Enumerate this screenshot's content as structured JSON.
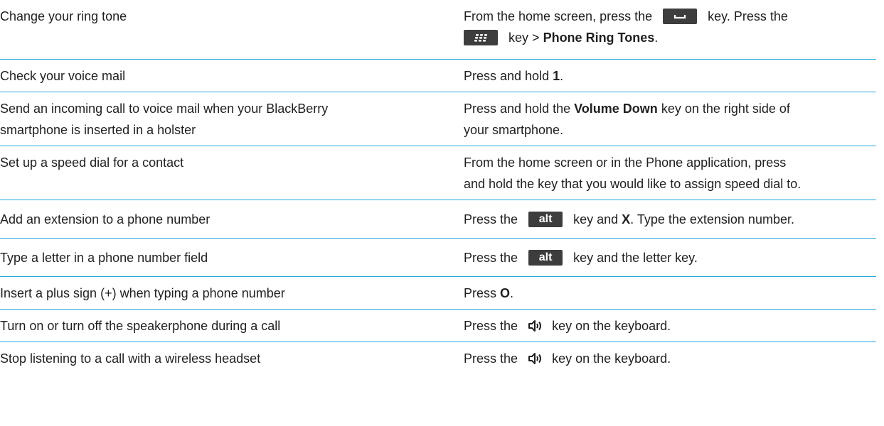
{
  "rows": [
    {
      "task": "Change your ring tone",
      "a1": "From the home screen, press the",
      "a2": "key. Press the",
      "a3": "key >",
      "b1": "Phone Ring Tones",
      "a4": "."
    },
    {
      "task": "Check your voice mail",
      "a1": "Press and hold",
      "b1": "1",
      "a2": "."
    },
    {
      "task_l1": "Send an incoming call to voice mail when your BlackBerry",
      "task_l2": "smartphone is inserted in a holster",
      "a1": "Press and hold the",
      "b1": "Volume Down",
      "a2": "key on the right side of",
      "a3": "your smartphone."
    },
    {
      "task": "Set up a speed dial for a contact",
      "a1": "From the home screen or in the Phone application, press",
      "a2": "and hold the key that you would like to assign speed dial to."
    },
    {
      "task": "Add an extension to a phone number",
      "a1": "Press the",
      "key": "alt",
      "a2": "key and",
      "b1": "X",
      "a3": ". Type the extension number."
    },
    {
      "task": "Type a letter in a phone number field",
      "a1": "Press the",
      "key": "alt",
      "a2": "key and the letter key."
    },
    {
      "task": "Insert a plus sign (+) when typing a phone number",
      "a1": "Press",
      "b1": "O",
      "a2": "."
    },
    {
      "task": "Turn on or turn off the speakerphone during a call",
      "a1": "Press the",
      "a2": "key on the keyboard."
    },
    {
      "task": "Stop listening to a call with a wireless headset",
      "a1": "Press the",
      "a2": "key on the keyboard."
    }
  ],
  "colors": {
    "divider": "#29a9e0",
    "key_background": "#3d3d3d",
    "text": "#1f1f1f"
  }
}
